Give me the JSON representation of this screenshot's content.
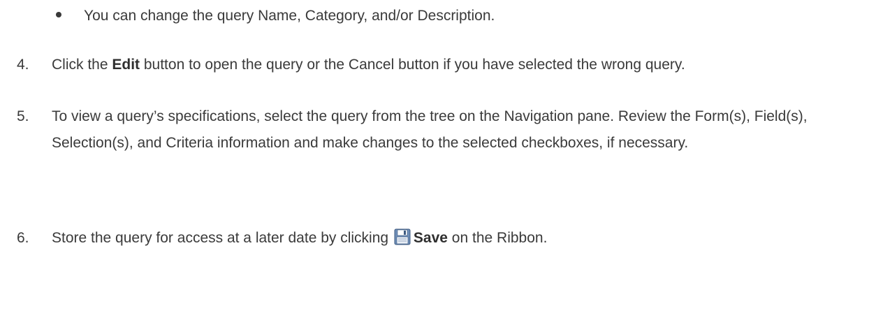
{
  "bullet": {
    "text": "You can change the query Name, Category, and/or Description."
  },
  "steps": [
    {
      "number": "4.",
      "pre": "Click the ",
      "bold": "Edit",
      "post": " button to open the query or the Cancel button if you have selected the wrong query."
    },
    {
      "number": "5.",
      "text": "To view a query’s specifications, select the query from the tree on the Navigation pane. Review the Form(s), Field(s), Selection(s), and Criteria information and make changes to the selected checkboxes, if necessary."
    },
    {
      "number": "6.",
      "pre": "Store the query for access at a later date by clicking ",
      "icon": "save-icon",
      "bold": "Save",
      "post": " on the Ribbon."
    }
  ]
}
